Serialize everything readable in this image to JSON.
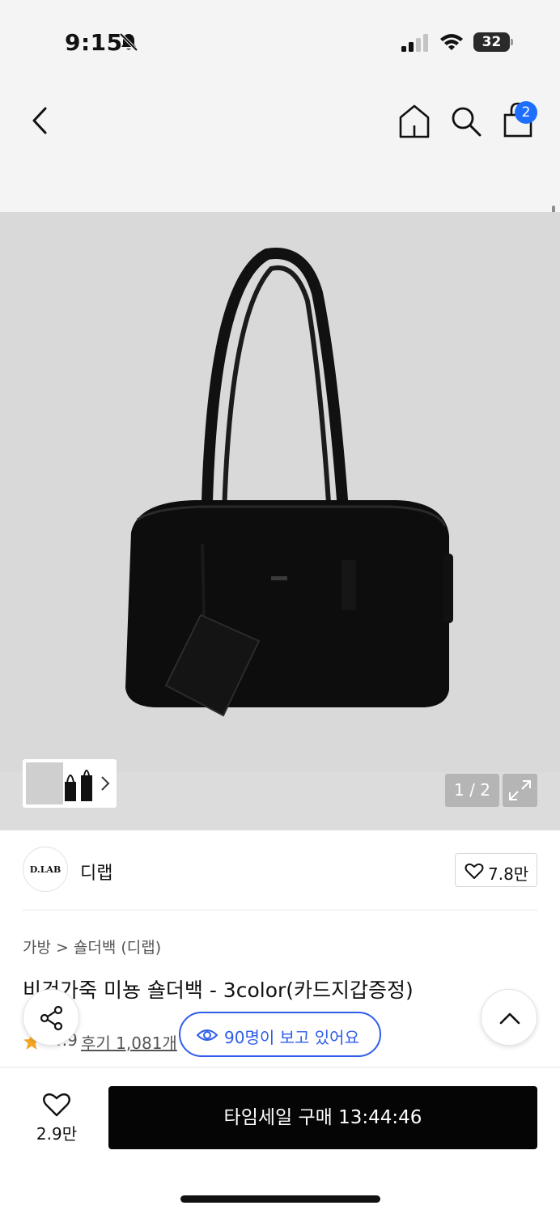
{
  "status_bar": {
    "time": "9:15",
    "battery": "32",
    "icons": [
      "bell-off-icon",
      "signal-icon",
      "wifi-icon",
      "battery-icon"
    ]
  },
  "nav": {
    "icons": [
      "back-icon",
      "home-icon",
      "search-icon",
      "shopping-bag-icon"
    ],
    "cart_badge": "2"
  },
  "gallery": {
    "counter": "1 / 2",
    "icons": [
      "chevron-right-icon",
      "expand-icon"
    ]
  },
  "brand": {
    "logo_text": "D.LAB",
    "name": "디랩",
    "like_count": "7.8만"
  },
  "breadcrumb": {
    "items": [
      "가방",
      "숄더백 (디랩)"
    ],
    "separator": ">"
  },
  "product": {
    "title": "비건가죽 미뇽 숄더백 - 3color(카드지갑증정)",
    "rating": "4.9",
    "reviews": "후기 1,081개"
  },
  "floating": {
    "viewers": "90명이 보고 있어요"
  },
  "bottom_bar": {
    "wish_count": "2.9만",
    "buy_label": "타임세일 구매 13:44:46"
  },
  "colors": {
    "accent_blue": "#2f5de8",
    "badge_blue": "#1f6fff",
    "star": "#f5a623",
    "buy_button": "#050505"
  }
}
